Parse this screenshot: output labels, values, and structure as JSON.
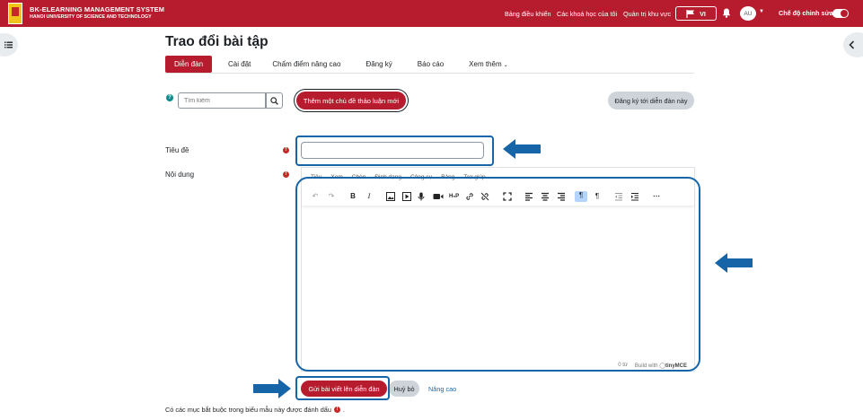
{
  "header": {
    "brand_title": "BK-ELEARNING MANAGEMENT SYSTEM",
    "brand_subtitle": "HANOI UNIVERSITY OF SCIENCE AND TECHNOLOGY",
    "nav": [
      "Bảng điều khiển",
      "Các khoá học của tôi",
      "Quản trị khu vực"
    ],
    "language": "VI",
    "avatar_initials": "AU",
    "edit_mode_label": "Chế độ chỉnh sửa",
    "edit_mode_on": true
  },
  "page": {
    "title": "Trao đổi bài tập",
    "tabs": [
      "Diễn đàn",
      "Cài đặt",
      "Chấm điểm nâng cao",
      "Đăng ký",
      "Báo cáo",
      "Xem thêm"
    ]
  },
  "forum_actions": {
    "help_icon": "?",
    "search_placeholder": "Tìm kiếm",
    "new_topic_label": "Thêm một chủ đề thảo luận mới",
    "subscribe_label": "Đăng ký tới diễn đàn này"
  },
  "form": {
    "subject_label": "Tiêu đề",
    "message_label": "Nội dung",
    "required_icon": "!",
    "editor_menu": [
      "Tiêu",
      "Xem",
      "Chèn",
      "Định dạng",
      "Công cụ",
      "Bảng",
      "Trợ giúp"
    ],
    "word_count": "0 từ",
    "built_with": "Build with",
    "editor_brand": "tinyMCE",
    "submit_label": "Gửi bài viết lên diễn đàn",
    "cancel_label": "Huỷ bỏ",
    "advanced_label": "Nâng cao",
    "required_note": "Có các mục bắt buộc trong biểu mẫu này được đánh dấu"
  },
  "annotation_color": "#1565a8",
  "accent_color": "#b71c2e"
}
